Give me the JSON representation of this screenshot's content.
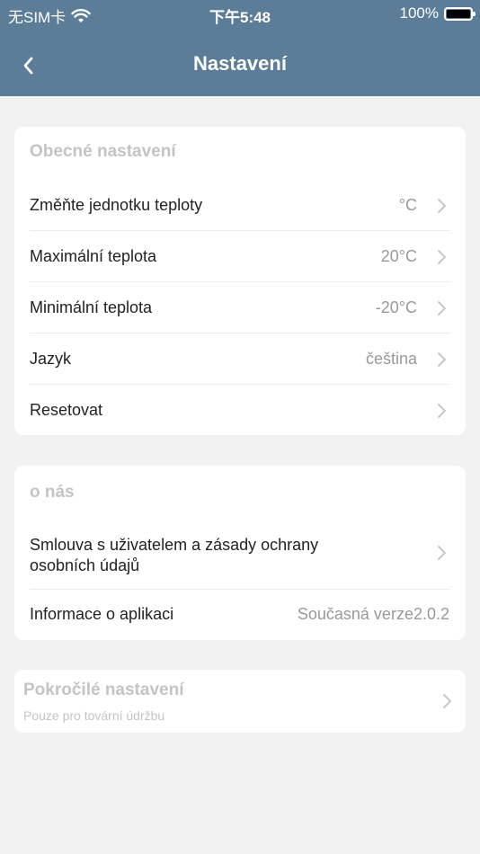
{
  "status_bar": {
    "carrier": "无SIM卡",
    "time": "下午5:48",
    "battery": "100%"
  },
  "nav": {
    "title": "Nastavení"
  },
  "general": {
    "title": "Obecné nastavení",
    "items": [
      {
        "label": "Změňte jednotku teploty",
        "value": "°C"
      },
      {
        "label": "Maximální teplota",
        "value": "20°C"
      },
      {
        "label": "Minimální teplota",
        "value": "-20°C"
      },
      {
        "label": "Jazyk",
        "value": "čeština"
      },
      {
        "label": "Resetovat",
        "value": ""
      }
    ]
  },
  "about": {
    "title": "o nás",
    "privacy_label_line1": "Smlouva s uživatelem a zásady ochrany",
    "privacy_label_line2": "osobních údajů",
    "app_info_label": "Informace o aplikaci",
    "app_info_value": "Současná verze2.0.2"
  },
  "advanced": {
    "title": "Pokročilé nastavení",
    "subtitle": "Pouze pro tovární údržbu"
  }
}
